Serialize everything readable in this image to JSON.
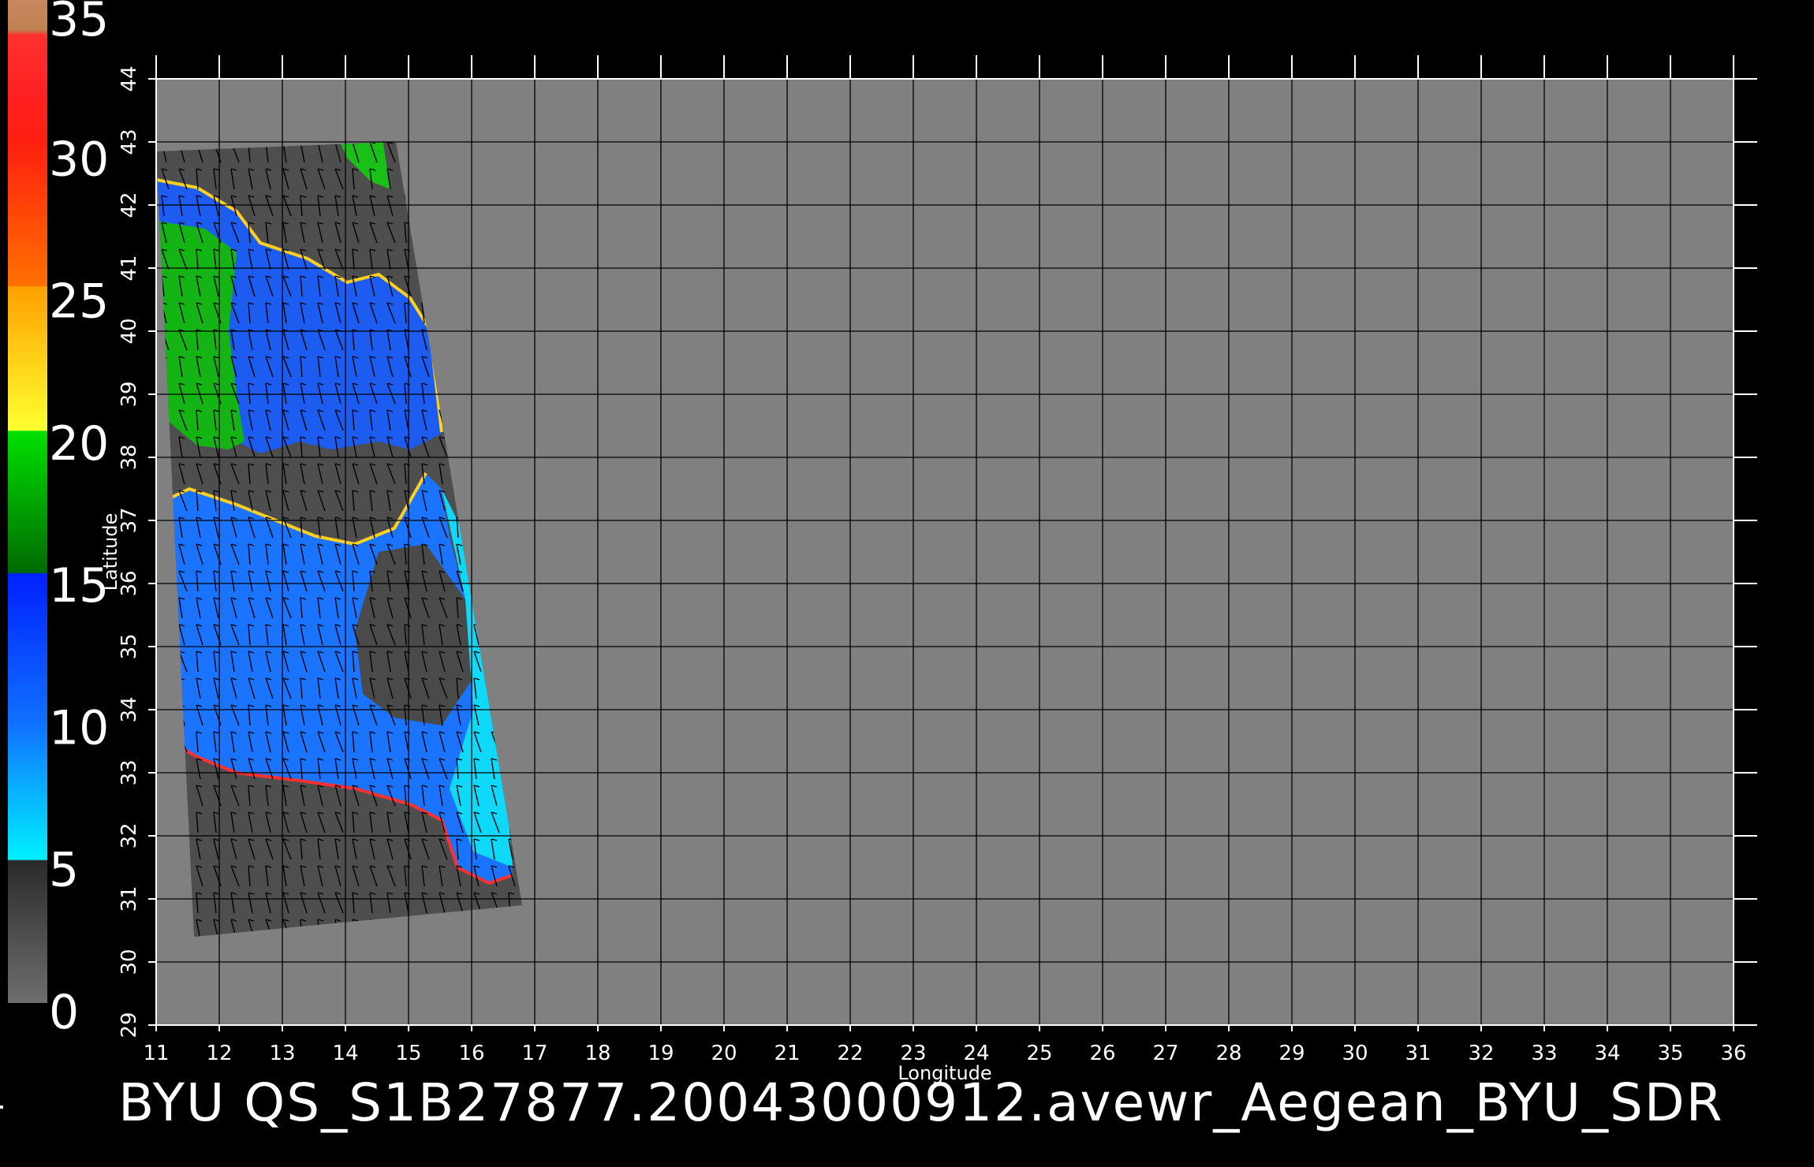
{
  "caption": "BYU  QS_S1B27877.20043000912.avewr_Aegean_BYU_SDR",
  "axes": {
    "xlabel": "Longitude",
    "ylabel": "Latitude",
    "x_ticks": [
      "11",
      "12",
      "13",
      "14",
      "15",
      "16",
      "17",
      "18",
      "19",
      "20",
      "21",
      "22",
      "23",
      "24",
      "25",
      "26",
      "27",
      "28",
      "29",
      "30",
      "31",
      "32",
      "33",
      "34",
      "35",
      "36"
    ],
    "y_ticks": [
      "29",
      "30",
      "31",
      "32",
      "33",
      "34",
      "35",
      "36",
      "37",
      "38",
      "39",
      "40",
      "41",
      "42",
      "43",
      "44"
    ]
  },
  "colorbar": {
    "labels": [
      "0",
      "5",
      "10",
      "15",
      "20",
      "25",
      "30",
      "35"
    ],
    "colors": {
      "gray_low": "#5a5a5a",
      "gray_high": "#222222",
      "cyan": "#00f0ff",
      "blue": "#0038ff",
      "green": "#00a000",
      "yellow": "#ffff40",
      "orange": "#ff9000",
      "red": "#ff2020",
      "tan": "#c08050"
    }
  },
  "colors": {
    "background": "#000000",
    "plot_fill": "#808080",
    "swath_dark": "#4e4e4e",
    "grid": "#000000",
    "text": "#ffffff"
  },
  "map_data": {
    "type": "wind-speed swath",
    "lon_range": [
      11,
      36
    ],
    "lat_range": [
      29,
      44
    ],
    "swath_corners": [
      [
        11.0,
        42.85
      ],
      [
        14.8,
        43.0
      ],
      [
        16.8,
        30.9
      ],
      [
        11.6,
        30.4
      ]
    ]
  }
}
